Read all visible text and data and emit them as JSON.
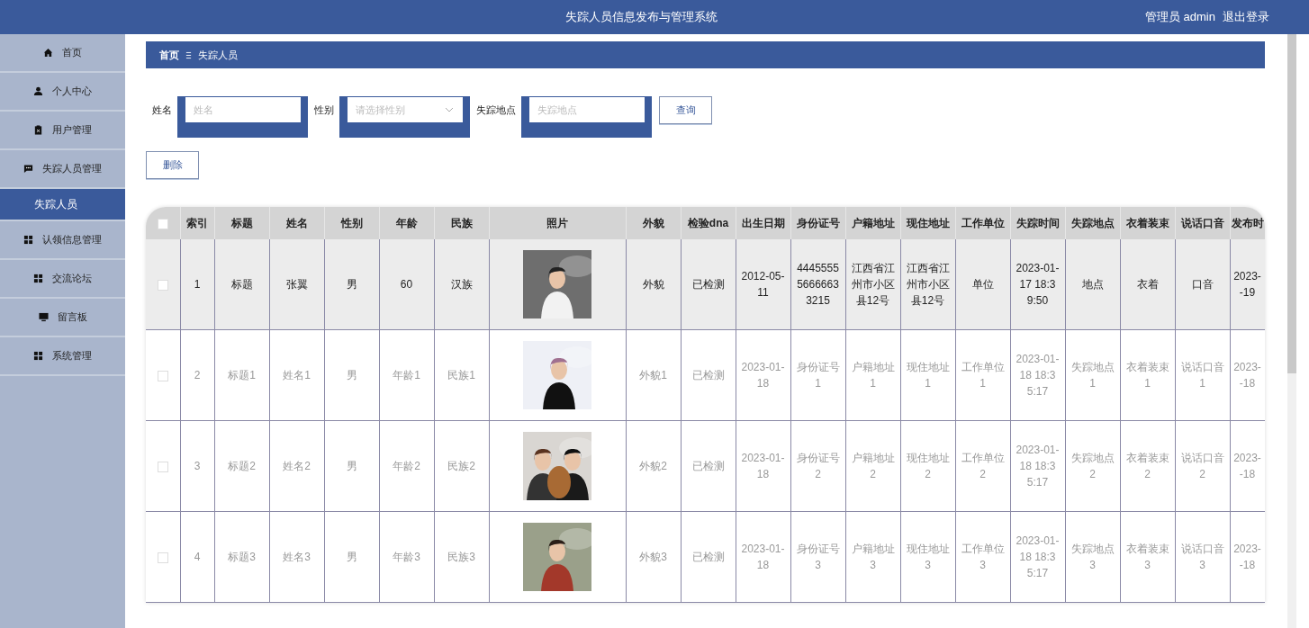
{
  "header": {
    "title": "失踪人员信息发布与管理系统",
    "user": "管理员 admin",
    "logout": "退出登录"
  },
  "sidebar": {
    "items": [
      {
        "label": "首页",
        "selected": false
      },
      {
        "label": "个人中心",
        "selected": false
      },
      {
        "label": "用户管理",
        "selected": false
      },
      {
        "label": "失踪人员管理",
        "selected": false,
        "expanded": true,
        "children": [
          {
            "label": "失踪人员",
            "selected": true
          }
        ]
      },
      {
        "label": "认领信息管理",
        "selected": false
      },
      {
        "label": "交流论坛",
        "selected": false
      },
      {
        "label": "留言板",
        "selected": false
      },
      {
        "label": "系统管理",
        "selected": false
      }
    ]
  },
  "breadcrumb": [
    "首页",
    "失踪人员"
  ],
  "search": {
    "fields": [
      {
        "label": "姓名",
        "kind": "input",
        "placeholder": "姓名"
      },
      {
        "label": "性别",
        "kind": "select",
        "placeholder": "请选择性别"
      },
      {
        "label": "失踪地点",
        "kind": "input",
        "placeholder": "失踪地点"
      }
    ],
    "button": "查询"
  },
  "delete_button": "删除",
  "table": {
    "header_checked": false,
    "columns": [
      "索引",
      "标题",
      "姓名",
      "性别",
      "年龄",
      "民族",
      "照片",
      "外貌",
      "检验dna",
      "出生日期",
      "身份证号",
      "户籍地址",
      "现住地址",
      "工作单位",
      "失踪时间",
      "失踪地点",
      "衣着装束",
      "说话口音",
      "发布时"
    ],
    "rows": [
      {
        "selected": true,
        "checked": false,
        "cells": [
          "1",
          "标题",
          "张翼",
          "男",
          "60",
          "汉族",
          {
            "kind": "picture"
          },
          "外貌",
          "已检测",
          "2012-05-11",
          "444555556666633215",
          "江西省江州市小区县12号",
          "江西省江州市小区县12号",
          "单位",
          "2023-01-17 18:39:50",
          "地点",
          "衣着",
          "口音",
          "2023-\n-19"
        ]
      },
      {
        "selected": false,
        "checked": false,
        "cells": [
          "2",
          "标题1",
          "姓名1",
          "男",
          "年龄1",
          "民族1",
          {
            "kind": "picture"
          },
          "外貌1",
          "已检测",
          "2023-01-18",
          "身份证号1",
          "户籍地址1",
          "现住地址1",
          "工作单位1",
          "2023-01-18 18:35:17",
          "失踪地点1",
          "衣着装束1",
          "说话口音1",
          "2023-\n-18"
        ]
      },
      {
        "selected": false,
        "checked": false,
        "cells": [
          "3",
          "标题2",
          "姓名2",
          "男",
          "年龄2",
          "民族2",
          {
            "kind": "picture"
          },
          "外貌2",
          "已检测",
          "2023-01-18",
          "身份证号2",
          "户籍地址2",
          "现住地址2",
          "工作单位2",
          "2023-01-18 18:35:17",
          "失踪地点2",
          "衣着装束2",
          "说话口音2",
          "2023-\n-18"
        ]
      },
      {
        "selected": false,
        "checked": false,
        "cells": [
          "4",
          "标题3",
          "姓名3",
          "男",
          "年龄3",
          "民族3",
          {
            "kind": "picture"
          },
          "外貌3",
          "已检测",
          "2023-01-18",
          "身份证号3",
          "户籍地址3",
          "现住地址3",
          "工作单位3",
          "2023-01-18 18:35:17",
          "失踪地点3",
          "衣着装束3",
          "说话口音3",
          "2023-\n-18"
        ]
      }
    ]
  }
}
